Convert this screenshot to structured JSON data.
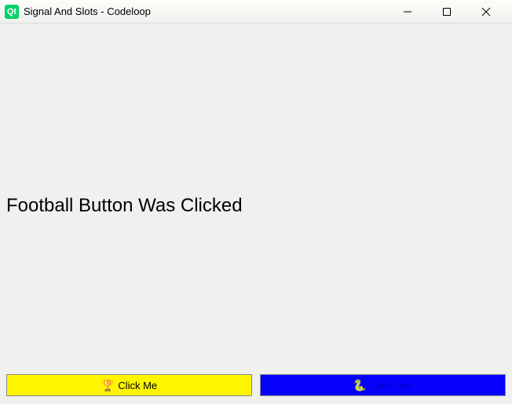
{
  "titlebar": {
    "icon_text": "Qt",
    "title": "Signal And Slots - Codeloop"
  },
  "main": {
    "message": "Football Button Was Clicked"
  },
  "buttons": {
    "left": {
      "icon": "🏆",
      "label": "Click Me"
    },
    "right": {
      "icon": "🐍",
      "label": "Click Two"
    }
  }
}
